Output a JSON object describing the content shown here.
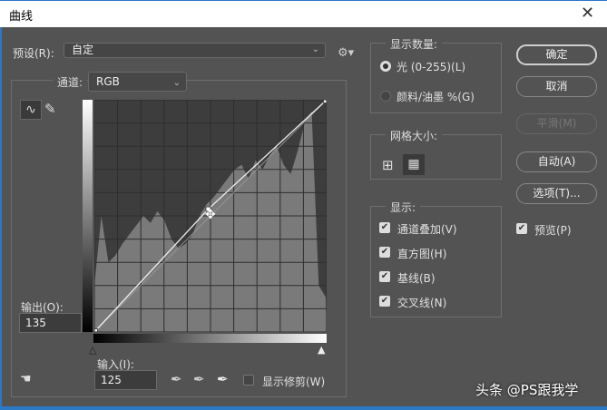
{
  "title": "曲线",
  "preset": {
    "label": "预设(R):",
    "value": "自定"
  },
  "channel": {
    "label": "通道:",
    "value": "RGB"
  },
  "output": {
    "label": "输出(O):",
    "value": "135"
  },
  "input": {
    "label": "输入(I):",
    "value": "125"
  },
  "show_clipping": {
    "label": "显示修剪(W)",
    "checked": false
  },
  "show_amount": {
    "title": "显示数量:",
    "options": [
      {
        "label": "光 (0-255)(L)",
        "selected": true
      },
      {
        "label": "颜料/油墨 %(G)",
        "selected": false
      }
    ]
  },
  "grid_size": {
    "title": "网格大小:"
  },
  "display": {
    "title": "显示:",
    "options": [
      {
        "label": "通道叠加(V)",
        "checked": true
      },
      {
        "label": "直方图(H)",
        "checked": true
      },
      {
        "label": "基线(B)",
        "checked": true
      },
      {
        "label": "交叉线(N)",
        "checked": true
      }
    ]
  },
  "buttons": {
    "ok": "确定",
    "cancel": "取消",
    "smooth": "平滑(M)",
    "auto": "自动(A)",
    "options": "选项(T)..."
  },
  "preview": {
    "label": "预览(P)",
    "checked": true
  },
  "curve_points": [
    [
      0,
      0
    ],
    [
      125,
      135
    ],
    [
      255,
      255
    ]
  ],
  "histogram": [
    0.2,
    0.5,
    0.3,
    0.33,
    0.38,
    0.42,
    0.46,
    0.5,
    0.47,
    0.52,
    0.48,
    0.4,
    0.36,
    0.38,
    0.42,
    0.5,
    0.55,
    0.58,
    0.62,
    0.66,
    0.7,
    0.72,
    0.66,
    0.74,
    0.7,
    0.76,
    0.8,
    0.72,
    0.68,
    0.78,
    0.9,
    0.95,
    0.2,
    0.15
  ],
  "watermark": "头条 @PS跟我学"
}
